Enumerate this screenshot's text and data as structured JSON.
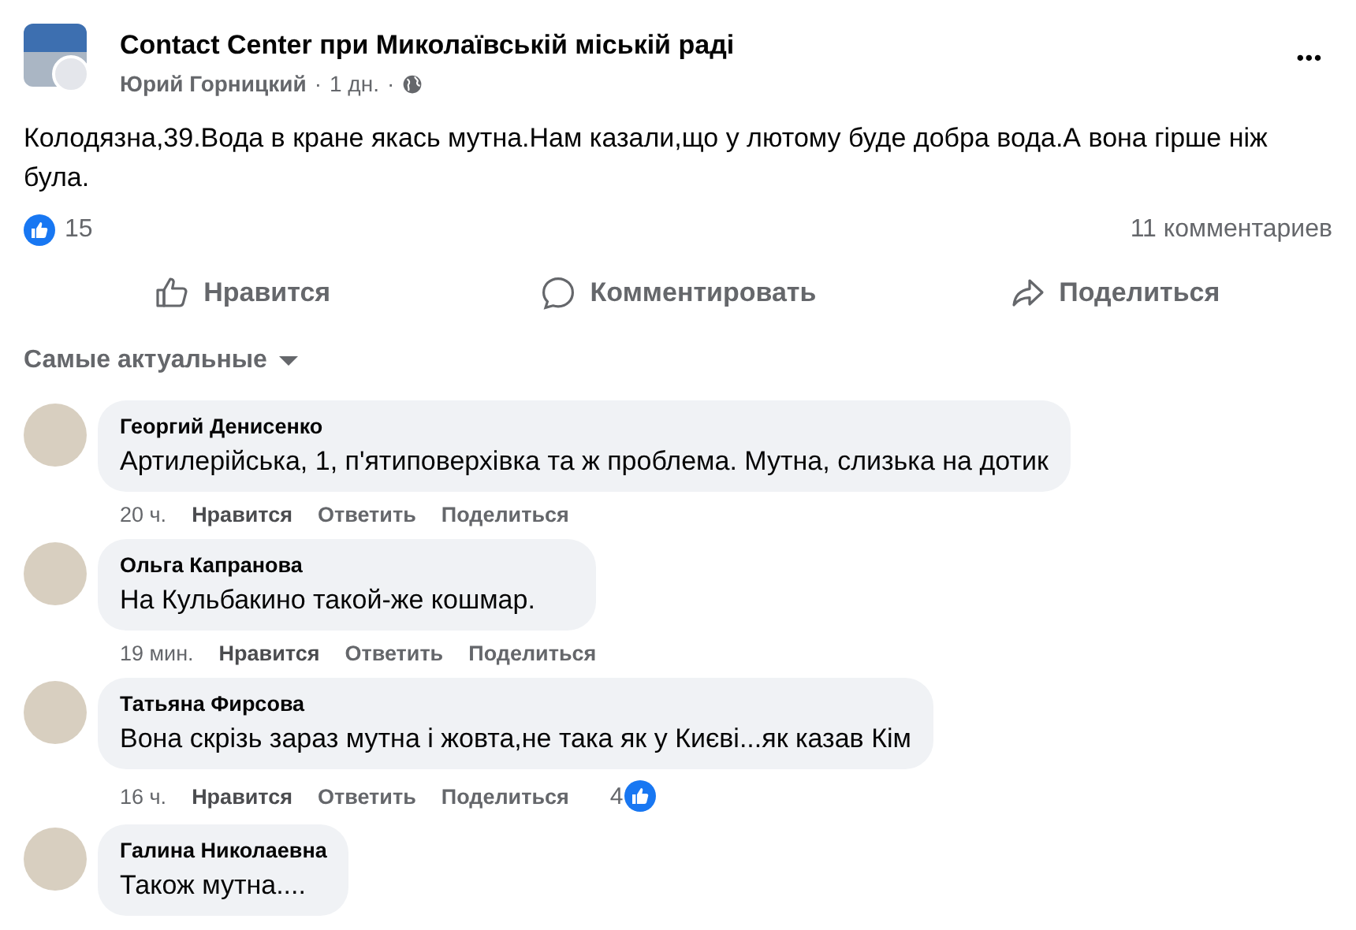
{
  "post": {
    "page_name": "Contact Center при Миколаївській міській раді",
    "author": "Юрий Горницкий",
    "separator": "·",
    "time": "1 дн.",
    "separator_2": "·",
    "menu": "•••",
    "text": "Колодязна,39.Вода в кране якась мутна.Нам казали,що у лютому буде добра вода.А вона гірше ніж була.",
    "reactions_count": "15",
    "comments_count": "11 комментариев",
    "actions": [
      {
        "kind": "like",
        "label": "Нравится"
      },
      {
        "kind": "comment",
        "label": "Комментировать"
      },
      {
        "kind": "share",
        "label": "Поделиться"
      }
    ],
    "sort_label": "Самые актуальные"
  },
  "comments": [
    {
      "author": "Георгий Денисенко",
      "text": "Артилерійська, 1, п'ятиповерхівка та ж проблема. Мутна, слизька на дотик",
      "time": "20 ч.",
      "like": "Нравится",
      "reply": "Ответить",
      "share": "Поделиться"
    },
    {
      "author": "Ольга Капранова",
      "text": "На Кульбакино такой-же кошмар.",
      "time": "19 мин.",
      "like": "Нравится",
      "reply": "Ответить",
      "share": "Поделиться"
    },
    {
      "author": "Татьяна Фирсова",
      "text": "Вона скрізь зараз мутна і жовта,не така як у Києві...як казав Кім",
      "time": "16 ч.",
      "like": "Нравится",
      "reply": "Ответить",
      "share": "Поделиться",
      "reactions": "4"
    },
    {
      "author": "Галина Николаевна",
      "text": "Також мутна...."
    }
  ]
}
